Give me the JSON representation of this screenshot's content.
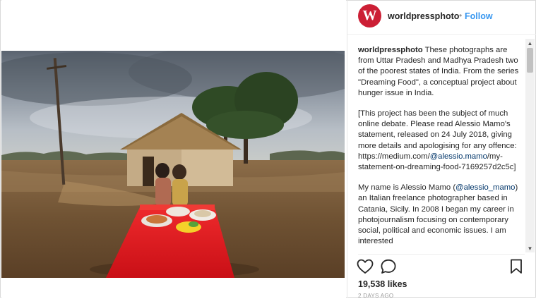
{
  "header": {
    "avatar_letter": "W",
    "username": "worldpressphoto",
    "separator": "•",
    "follow_label": "Follow"
  },
  "caption": {
    "username": "worldpressphoto",
    "intro": " These photographs are from Uttar Pradesh and Madhya Pradesh two of the poorest states of India. From the series \"Dreaming Food\", a conceptual project about hunger issue in India.",
    "para2_before": "[This project has been the subject of much online debate. Please read Alessio Mamo's statement, released on 24 July 2018, giving more details and apologising for any offence: https://medium.com/",
    "para2_mention": "@alessio.mamo",
    "para2_after": "/my-statement-on-dreaming-food-7169257d2c5c]",
    "para3_before": "My name is Alessio Mamo (",
    "para3_mention": "@alessio_mamo",
    "para3_after": ") an Italian freelance photographer based in Catania, Sicily. In 2008 I began my career in photojournalism focusing on contemporary social, political and economic issues. I am interested"
  },
  "actions": {
    "like_icon": "heart-outline-icon",
    "comment_icon": "comment-bubble-icon",
    "save_icon": "bookmark-outline-icon"
  },
  "likes_text": "19,538 likes",
  "time_text": "2 DAYS AGO",
  "colors": {
    "brand": "#cc1f35",
    "follow": "#3897f0",
    "link": "#003569",
    "table_cloth": "#e0141c"
  }
}
